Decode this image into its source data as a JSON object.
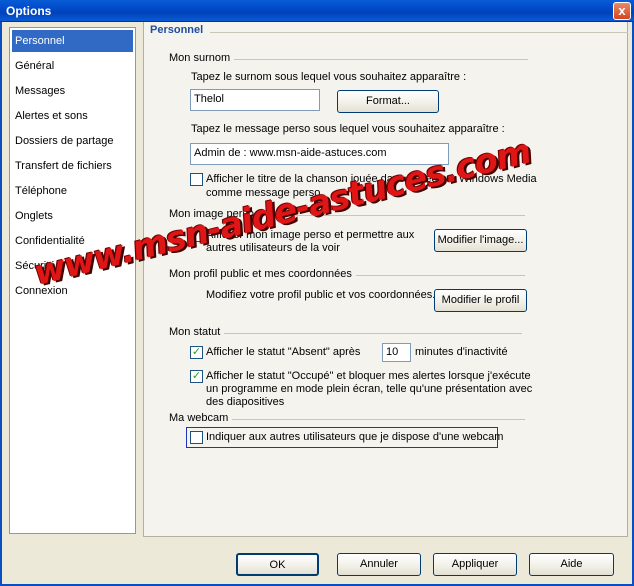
{
  "window": {
    "title": "Options",
    "close_label": "x"
  },
  "sidebar": {
    "items": [
      {
        "label": "Personnel",
        "selected": true
      },
      {
        "label": "Général"
      },
      {
        "label": "Messages"
      },
      {
        "label": "Alertes et sons"
      },
      {
        "label": "Dossiers de partage"
      },
      {
        "label": "Transfert de fichiers"
      },
      {
        "label": "Téléphone"
      },
      {
        "label": "Onglets"
      },
      {
        "label": "Confidentialité"
      },
      {
        "label": "Sécurité"
      },
      {
        "label": "Connexion"
      }
    ]
  },
  "panel": {
    "title": "Personnel",
    "surnom": {
      "group_label": "Mon surnom",
      "prompt": "Tapez le surnom sous lequel vous souhaitez apparaître :",
      "value": "Thelol",
      "format_button": "Format...",
      "message_prompt": "Tapez le message perso sous lequel vous souhaitez apparaître :",
      "message_value": "Admin de : www.msn-aide-astuces.com",
      "song_checkbox_label_1": "Afficher le titre de la chanson jouée dans le Lecteur Windows Media",
      "song_checkbox_label_2": "comme message perso",
      "song_checked": false
    },
    "image": {
      "group_label": "Mon image perso",
      "checkbox_label_1": "Afficher mon image perso et permettre aux",
      "checkbox_label_2": "autres utilisateurs de la voir",
      "checked": true,
      "modify_button": "Modifier l'image..."
    },
    "profil": {
      "group_label": "Mon profil public et mes coordonnées",
      "text": "Modifiez votre profil public et vos coordonnées.",
      "modify_button": "Modifier le profil"
    },
    "statut": {
      "group_label": "Mon statut",
      "absent_label": "Afficher le statut \"Absent\" après",
      "absent_checked": true,
      "minutes_value": "10",
      "minutes_suffix": "minutes d'inactivité",
      "occupe_label_1": "Afficher le statut \"Occupé\" et bloquer mes alertes lorsque j'exécute",
      "occupe_label_2": "un programme en mode plein écran, telle qu'une présentation avec",
      "occupe_label_3": "des diapositives",
      "occupe_checked": true
    },
    "webcam": {
      "group_label": "Ma webcam",
      "checkbox_label": "Indiquer aux autres utilisateurs que je dispose d'une webcam",
      "checked": false
    }
  },
  "footer": {
    "ok": "OK",
    "cancel": "Annuler",
    "apply": "Appliquer",
    "help": "Aide"
  },
  "watermark": "www.msn-aide-astuces.com",
  "colors": {
    "title_bar": "#0a5bd6",
    "selection": "#316ac5",
    "header_text": "#1f4e9c",
    "check": "#21a121"
  }
}
